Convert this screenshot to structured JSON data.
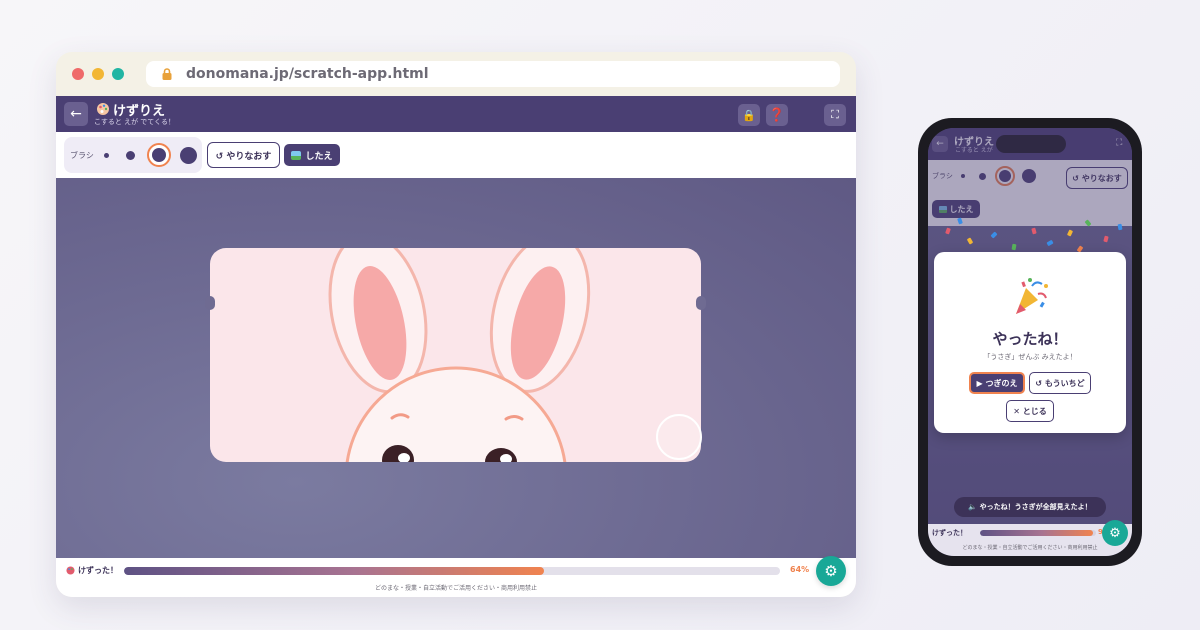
{
  "browser": {
    "url": "donomana.jp/scratch-app.html"
  },
  "app": {
    "back_icon": "←",
    "title": "けずりえ",
    "subtitle": "こすると えが でてくる！",
    "lock_icon": "🔒",
    "help_icon": "❓",
    "fullscreen_icon": "⛶"
  },
  "toolbar": {
    "brush_label": "ブラシ",
    "undo_label": "↺ やりなおす",
    "under_label": "したえ"
  },
  "progress": {
    "label": "けずった！",
    "percent_text": "64%",
    "percent": 64,
    "footer": "どのまな・授業・自立活動でご活用ください・商用利用禁止"
  },
  "phone": {
    "title": "けずりえ",
    "subtitle": "こすると えが",
    "brush_label": "ブラシ",
    "undo_label": "↺ やりなおす",
    "under_label": "したえ",
    "modal": {
      "title": "やったね！",
      "subtitle": "「うさぎ」ぜんぶ みえたよ！",
      "next_label": "▶ つぎのえ",
      "again_label": "↺ もういちど",
      "close_label": "✕ とじる"
    },
    "toast": "🔈 やったね！うさぎが全部見えたよ！",
    "progress_label": "けずった！",
    "percent_text": "97%",
    "percent": 97,
    "footer": "どのまな・授業・自立活動でご活用ください・商用利用禁止"
  },
  "gear_icon": "⚙",
  "colors": {
    "primary": "#4a3f73",
    "accent": "#f0834f",
    "teal": "#19a897"
  }
}
